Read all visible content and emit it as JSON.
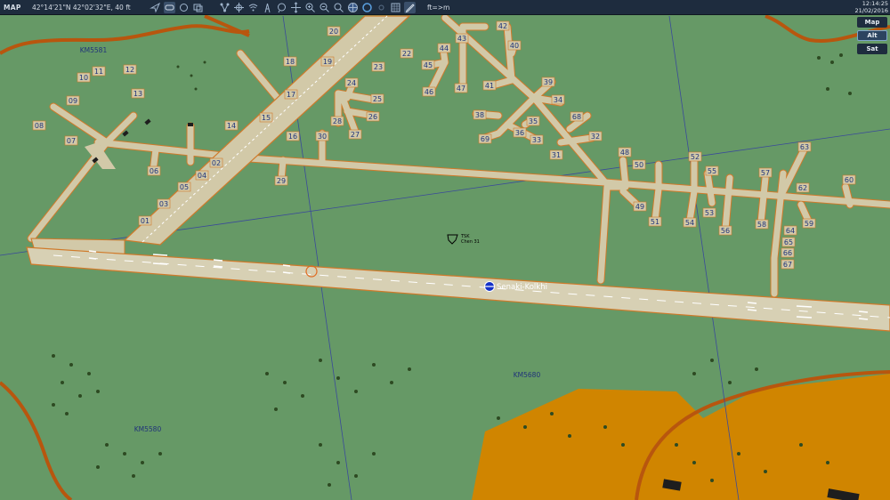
{
  "topbar": {
    "mode": "MAP",
    "coordinates": "42°14'21\"N 42°02'32\"E, 40 ft",
    "units": "ft=>m",
    "time": "12:14:25",
    "date": "21/02/2016"
  },
  "toolbar": {
    "icons": [
      "navigate-icon",
      "waypoint-tool-icon",
      "circle-tool-icon",
      "layers-tool-icon",
      "nodes-icon",
      "crosshair-icon",
      "wifi-icon",
      "tower-icon",
      "chat-icon",
      "move-icon",
      "zoom-in-icon",
      "zoom-out-icon",
      "zoom-fit-icon",
      "globe-icon",
      "rotate-icon",
      "sun-icon",
      "grid-icon",
      "pencil-icon"
    ]
  },
  "layer_buttons": {
    "map": "Map",
    "alt": "Alt",
    "sat": "Sat",
    "selected": "Alt"
  },
  "grid_labels": {
    "km5581": "KM5581",
    "km5680": "KM5680",
    "km5580": "KM5580"
  },
  "airfield": {
    "name": "Senaki-Kolkhi",
    "unit_label_1": "TSK",
    "unit_label_2": "Chen 31",
    "runway_markers": [
      "01",
      "02",
      "03",
      "04",
      "05",
      "06",
      "07",
      "08",
      "09",
      "10",
      "11",
      "12",
      "13",
      "14",
      "15",
      "16",
      "17",
      "18",
      "19",
      "20",
      "22",
      "23",
      "24",
      "25",
      "26",
      "27",
      "28",
      "29",
      "30",
      "31",
      "32",
      "33",
      "34",
      "35",
      "36",
      "38",
      "39",
      "40",
      "41",
      "42",
      "43",
      "44",
      "45",
      "46",
      "47",
      "48",
      "49",
      "50",
      "51",
      "52",
      "53",
      "54",
      "55",
      "56",
      "57",
      "58",
      "59",
      "60",
      "62",
      "63",
      "64",
      "65",
      "66",
      "67",
      "68",
      "69"
    ]
  },
  "colors": {
    "grass": "#669966",
    "tarmac": "#d2c9a8",
    "runway": "#d7d0b4",
    "orange_edge": "#d07a2a",
    "farmland": "#d08500",
    "road": "#b8560e",
    "grid_line": "#3a4a9a",
    "label": "#21337a",
    "topbar": "#1e2c3e"
  }
}
